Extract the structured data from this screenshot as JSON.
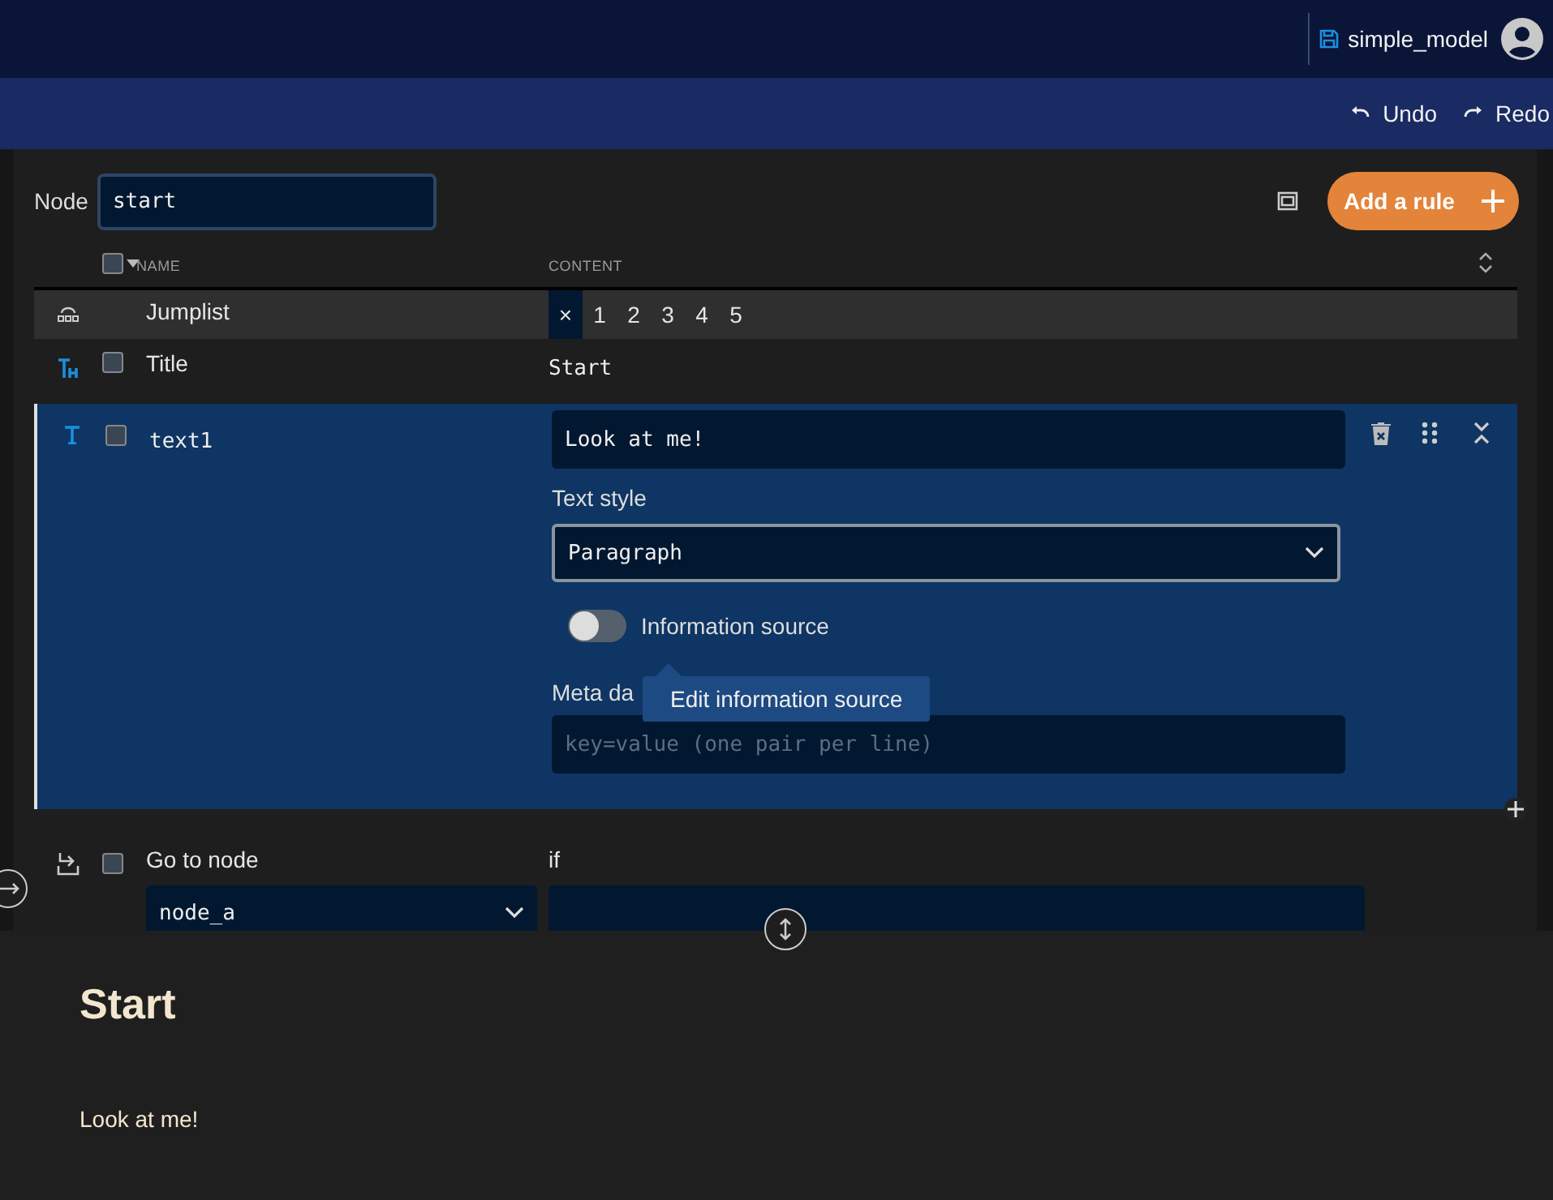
{
  "header": {
    "file_name": "simple_model"
  },
  "toolbar": {
    "actions": [
      {
        "kind": "undo",
        "label": "Undo"
      },
      {
        "kind": "redo",
        "label": "Redo"
      }
    ]
  },
  "editor": {
    "node_label": "Node",
    "node_value": "start",
    "add_button": "Add a rule",
    "select_all": false,
    "columns": [
      "NAME",
      "CONTENT"
    ],
    "rules": [
      {
        "kind": "jumplist",
        "name": "Jumplist",
        "clear": "×",
        "items": [
          "1",
          "2",
          "3",
          "4",
          "5"
        ]
      },
      {
        "kind": "title",
        "name": "Title",
        "checked": false,
        "content": "Start"
      },
      {
        "kind": "text",
        "name": "text1",
        "checked": false,
        "expanded": true,
        "value": "Look at me!",
        "style_label": "Text style",
        "style_value": "Paragraph",
        "info_source": {
          "label": "Information source",
          "on": false
        },
        "meta_label": "Meta da",
        "meta_placeholder": "key=value (one pair per line)",
        "tooltip": "Edit information source"
      },
      {
        "kind": "goto",
        "name": "Go to node",
        "checked": false,
        "target": "node_a",
        "condition_label": "if"
      }
    ]
  },
  "preview": {
    "title": "Start",
    "paragraph": "Look at me!"
  }
}
